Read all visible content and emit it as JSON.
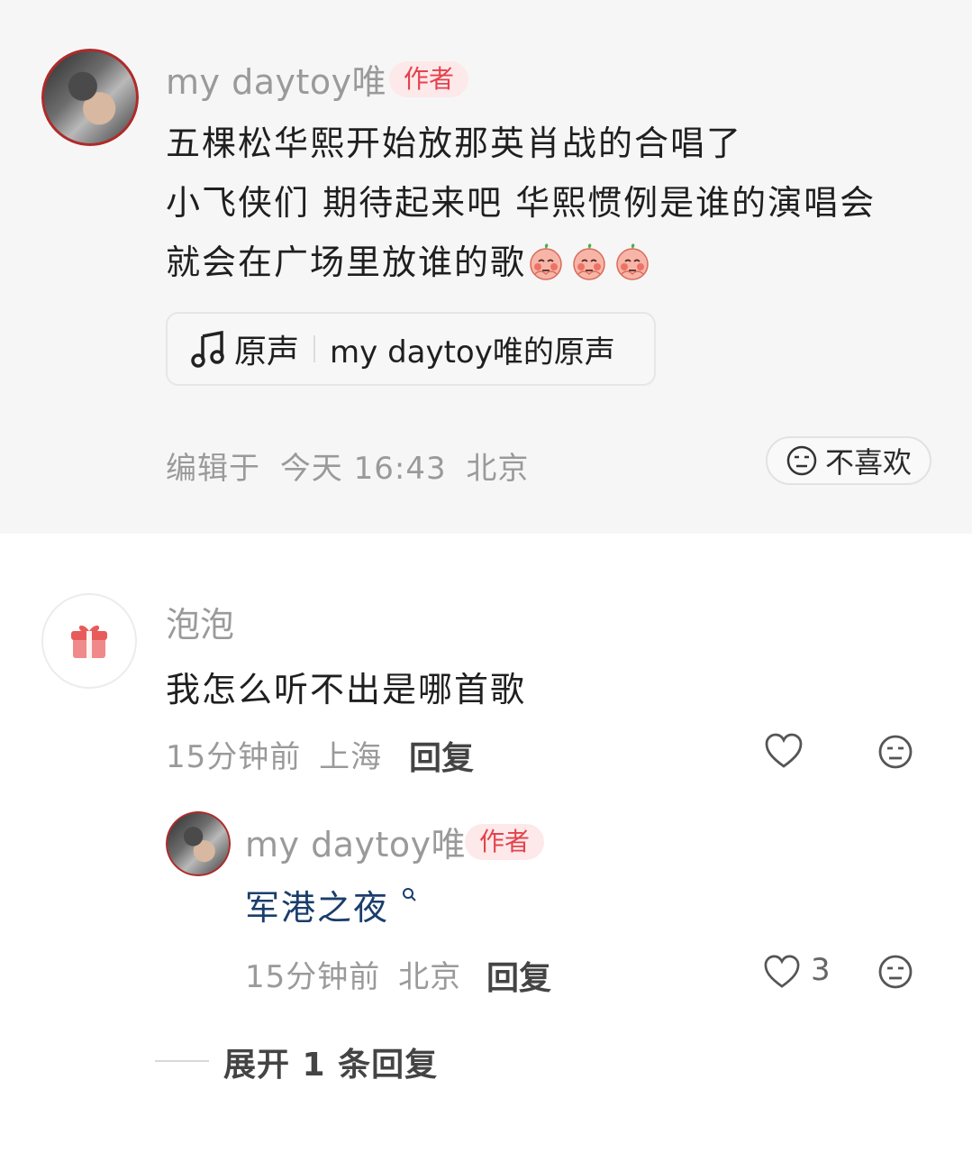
{
  "post": {
    "username": "my daytoy唯",
    "author_badge": "作者",
    "lines": [
      "五棵松华熙开始放那英肖战的合唱了",
      "小飞侠们 期待起来吧 华熙惯例是谁的演唱会",
      "就会在广场里放谁的歌"
    ],
    "emoji_icon": "peach-shy-emoji",
    "sound": {
      "label": "原声",
      "source": "my daytoy唯的原声",
      "icon": "music-note-icon"
    },
    "edited": "编辑于",
    "time": "今天 16:43",
    "location": "北京",
    "dislike_label": "不喜欢"
  },
  "comment": {
    "username": "泡泡",
    "avatar_icon": "gift-icon",
    "text": "我怎么听不出是哪首歌",
    "time": "15分钟前",
    "location": "上海",
    "reply_label": "回复"
  },
  "reply": {
    "username": "my daytoy唯",
    "author_badge": "作者",
    "text": "军港之夜",
    "search_icon": "search-icon",
    "time": "15分钟前",
    "location": "北京",
    "reply_label": "回复",
    "like_count": "3"
  },
  "expand_label": "展开 1 条回复",
  "colors": {
    "author_badge_bg": "#fde9ea",
    "author_badge_text": "#e5424d",
    "song_link": "#1a3e6b"
  }
}
